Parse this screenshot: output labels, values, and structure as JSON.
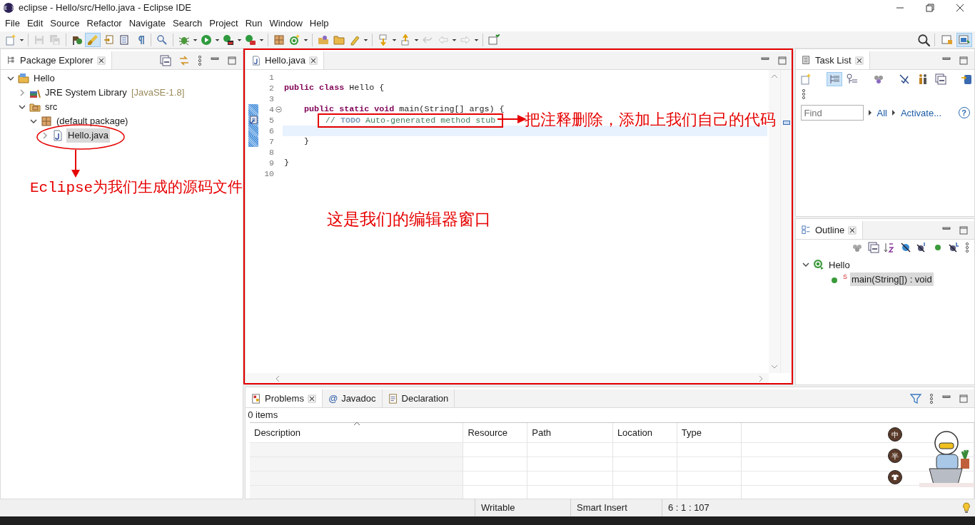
{
  "window": {
    "title": "eclipse - Hello/src/Hello.java - Eclipse IDE"
  },
  "menu": [
    "File",
    "Edit",
    "Source",
    "Refactor",
    "Navigate",
    "Search",
    "Project",
    "Run",
    "Window",
    "Help"
  ],
  "toolbar": [
    {
      "selected": false,
      "disabled": false
    },
    {
      "selected": false,
      "disabled": true
    },
    {
      "selected": false,
      "disabled": true
    },
    {
      "selected": false,
      "disabled": false
    },
    {
      "selected": true,
      "disabled": false
    },
    {
      "selected": false,
      "disabled": false
    },
    {
      "selected": false,
      "disabled": false
    },
    {
      "selected": false,
      "disabled": false
    },
    {
      "selected": false,
      "disabled": false
    },
    {
      "selected": false,
      "disabled": false
    },
    {
      "selected": false,
      "disabled": false
    },
    {
      "selected": false,
      "disabled": false
    },
    {
      "selected": false,
      "disabled": false
    },
    {
      "selected": false,
      "disabled": false
    },
    {
      "selected": false,
      "disabled": false
    },
    {
      "selected": false,
      "disabled": false
    },
    {
      "selected": false,
      "disabled": false
    },
    {
      "selected": false,
      "disabled": false
    },
    {
      "selected": false,
      "disabled": false
    },
    {
      "selected": false,
      "disabled": false
    },
    {
      "selected": false,
      "disabled": true
    },
    {
      "selected": false,
      "disabled": true
    },
    {
      "selected": false,
      "disabled": true
    },
    {
      "selected": false,
      "disabled": false
    }
  ],
  "perspectives": [
    {
      "selected": false
    },
    {
      "selected": true
    }
  ],
  "package_explorer": {
    "title": "Package Explorer",
    "tree": [
      {
        "label": "Hello",
        "kind": "project",
        "expanded": true,
        "selected": false,
        "children": [
          {
            "label": "JRE System Library",
            "suffix": "[JavaSE-1.8]",
            "kind": "library",
            "expanded": false,
            "selected": false
          },
          {
            "label": "src",
            "kind": "source-folder",
            "expanded": true,
            "selected": false,
            "children": [
              {
                "label": "(default package)",
                "kind": "package",
                "expanded": true,
                "selected": false,
                "children": [
                  {
                    "label": "Hello.java",
                    "kind": "java-file",
                    "expanded": false,
                    "selected": true
                  }
                ]
              }
            ]
          }
        ]
      }
    ]
  },
  "editor": {
    "tabs": [
      {
        "label": "Hello.java",
        "selected": true
      }
    ],
    "lines": [
      {
        "number": "1"
      },
      {
        "number": "2",
        "tokens": [
          {
            "kind": "keyword",
            "text": "public class"
          },
          {
            "kind": "plain",
            "text": " Hello {"
          }
        ]
      },
      {
        "number": "3"
      },
      {
        "number": "4",
        "tokens": [
          {
            "kind": "keyword",
            "text": "    public static void"
          },
          {
            "kind": "plain",
            "text": " main(String[] args) {"
          }
        ],
        "changed": true,
        "foldable": true
      },
      {
        "number": "5",
        "tokens": [
          {
            "kind": "comment",
            "text": "        // "
          },
          {
            "kind": "task-tag",
            "text": "TODO"
          },
          {
            "kind": "comment",
            "text": " Auto-generated method stub"
          }
        ],
        "changed": true,
        "task_marker": true,
        "boxed": true
      },
      {
        "number": "6",
        "current": true,
        "changed": true
      },
      {
        "number": "7",
        "tokens": [
          {
            "kind": "plain",
            "text": "    }"
          }
        ],
        "changed": true
      },
      {
        "number": "8"
      },
      {
        "number": "9",
        "tokens": [
          {
            "kind": "plain",
            "text": "}"
          }
        ]
      },
      {
        "number": "10"
      }
    ]
  },
  "task_list": {
    "title": "Task List",
    "find": {
      "placeholder": "Find"
    },
    "links": [
      "All",
      "Activate..."
    ],
    "help": "?"
  },
  "outline": {
    "title": "Outline",
    "tree": [
      {
        "label": "Hello",
        "kind": "class",
        "expanded": true,
        "selected": false,
        "children": [
          {
            "label": "main(String[]) : void",
            "kind": "method",
            "modifier": "S",
            "selected": true
          }
        ]
      }
    ]
  },
  "problems": {
    "tabs": [
      {
        "label": "Problems",
        "kind": "problems",
        "selected": true
      },
      {
        "label": "Javadoc",
        "kind": "javadoc",
        "glyph": "@",
        "selected": false
      },
      {
        "label": "Declaration",
        "kind": "declaration",
        "selected": false
      }
    ],
    "summary": "0 items",
    "columns": [
      "Description",
      "Resource",
      "Path",
      "Location",
      "Type"
    ]
  },
  "status_bar": [
    "Writable",
    "Smart Insert",
    "6 : 1 : 107"
  ],
  "ime": {
    "buttons": [
      "中",
      "半"
    ]
  },
  "annotations": [
    {
      "kind": "file-note",
      "text": "Eclipse为我们生成的源码文件"
    },
    {
      "kind": "comment-note",
      "text": "把注释删除，添加上我们自己的代码"
    },
    {
      "kind": "editor-note",
      "text": "这是我们的编辑器窗口"
    }
  ]
}
